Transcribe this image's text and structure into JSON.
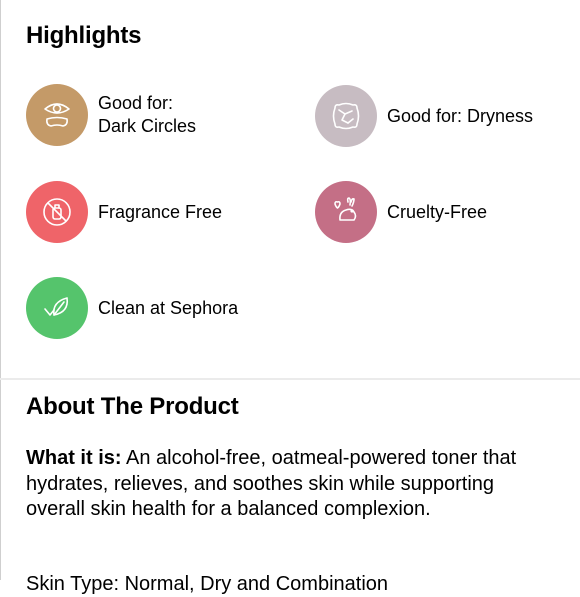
{
  "highlights": {
    "title": "Highlights",
    "items": [
      {
        "label_line1": "Good for:",
        "label_line2": "Dark Circles",
        "icon": "eye-patch-icon",
        "color": "#c49a68"
      },
      {
        "label_line1": "Good for: Dryness",
        "label_line2": "",
        "icon": "cracked-skin-icon",
        "color": "#c7bcc2"
      },
      {
        "label_line1": "Fragrance Free",
        "label_line2": "",
        "icon": "no-fragrance-icon",
        "color": "#ef6469"
      },
      {
        "label_line1": "Cruelty-Free",
        "label_line2": "",
        "icon": "bunny-heart-icon",
        "color": "#c46f86"
      },
      {
        "label_line1": "Clean at Sephora",
        "label_line2": "",
        "icon": "leaf-check-icon",
        "color": "#55c46c"
      }
    ]
  },
  "about": {
    "title": "About The Product",
    "what_label": "What it is:",
    "what_text": " An alcohol-free, oatmeal-powered toner that hydrates, relieves, and soothes skin while supporting overall skin health for a balanced complexion.",
    "cut_text": "Skin Type: Normal, Dry and Combination"
  }
}
